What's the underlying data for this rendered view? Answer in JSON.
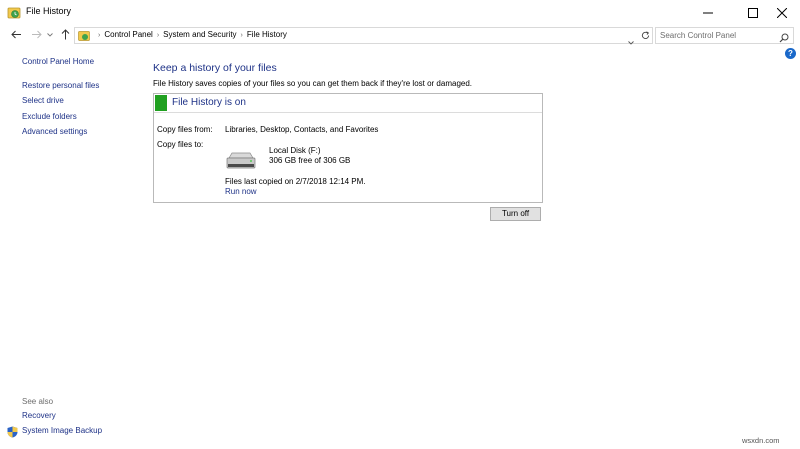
{
  "window": {
    "title": "File History"
  },
  "address": {
    "breadcrumbs": [
      "Control Panel",
      "System and Security",
      "File History"
    ]
  },
  "search": {
    "placeholder": "Search Control Panel"
  },
  "help": {
    "label": "?"
  },
  "sidebar": {
    "items": [
      {
        "label": "Control Panel Home"
      },
      {
        "label": "Restore personal files"
      },
      {
        "label": "Select drive"
      },
      {
        "label": "Exclude folders"
      },
      {
        "label": "Advanced settings"
      }
    ],
    "see_also_label": "See also",
    "see_also": [
      {
        "label": "Recovery"
      },
      {
        "label": "System Image Backup"
      }
    ]
  },
  "main": {
    "heading": "Keep a history of your files",
    "description": "File History saves copies of your files so you can get them back if they're lost or damaged.",
    "status": {
      "title": "File History is on",
      "copy_from_label": "Copy files from:",
      "copy_from_value": "Libraries, Desktop, Contacts, and Favorites",
      "copy_to_label": "Copy files to:",
      "drive_name": "Local Disk (F:)",
      "drive_space": "306 GB free of 306 GB",
      "last_copied": "Files last copied on 2/7/2018 12:14 PM.",
      "run_now": "Run now"
    },
    "turn_off_label": "Turn off"
  },
  "watermark": "wsxdn.com",
  "colors": {
    "accent": "#1e3287",
    "status_green": "#20a020",
    "help_blue": "#1a68c9"
  }
}
